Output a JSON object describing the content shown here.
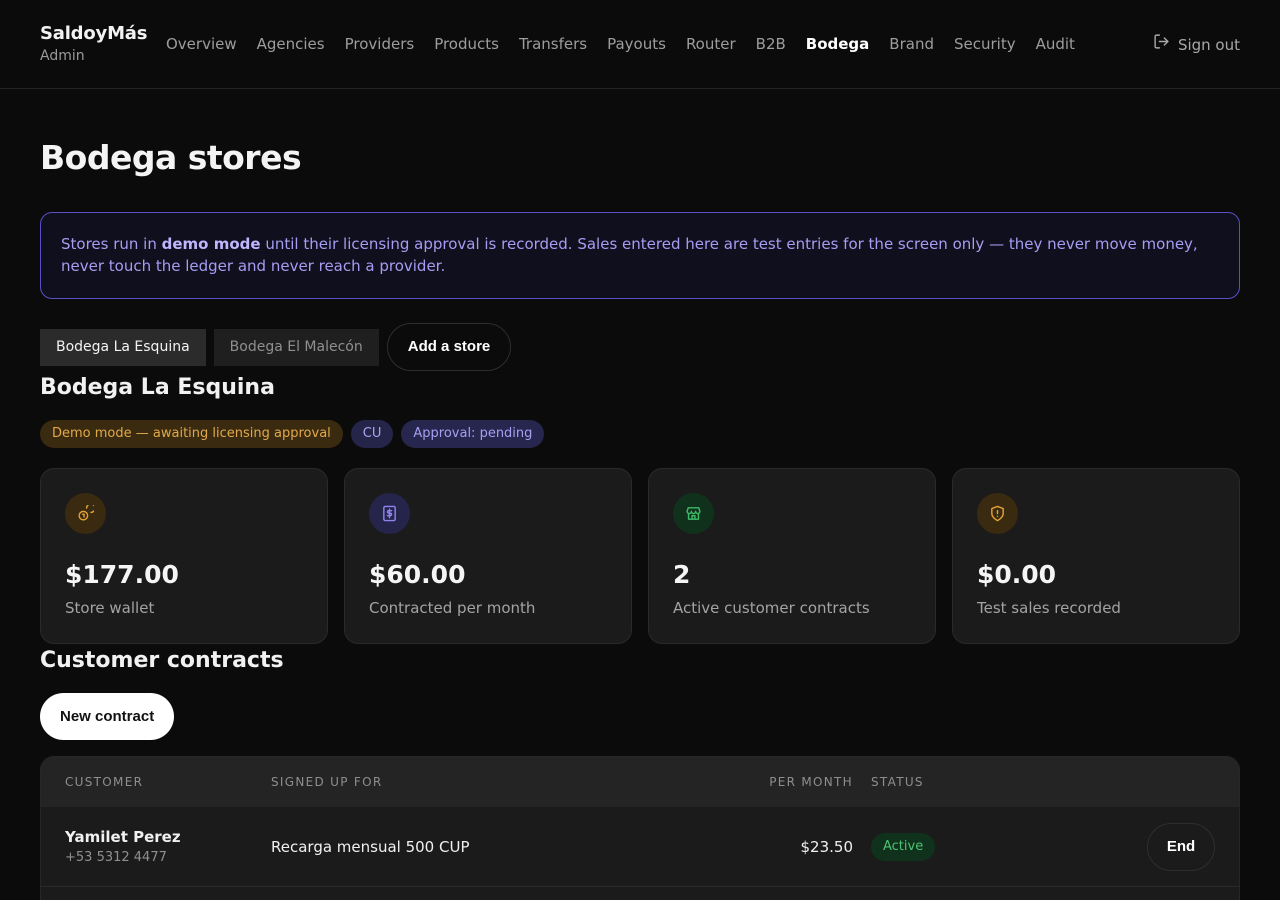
{
  "brand": {
    "name": "SaldoyMás",
    "subtitle": "Admin"
  },
  "nav": {
    "items": [
      {
        "label": "Overview"
      },
      {
        "label": "Agencies"
      },
      {
        "label": "Providers"
      },
      {
        "label": "Products"
      },
      {
        "label": "Transfers"
      },
      {
        "label": "Payouts"
      },
      {
        "label": "Router"
      },
      {
        "label": "B2B"
      },
      {
        "label": "Bodega",
        "active": true
      },
      {
        "label": "Brand"
      },
      {
        "label": "Security"
      },
      {
        "label": "Audit"
      }
    ],
    "signout_label": "Sign out"
  },
  "page": {
    "title": "Bodega stores"
  },
  "notice": {
    "prefix": "Stores run in ",
    "emphasis": "demo mode",
    "suffix": " until their licensing approval is recorded. Sales entered here are test entries for the screen only — they never move money, never touch the ledger and never reach a provider."
  },
  "store_tabs": {
    "tabs": [
      {
        "label": "Bodega La Esquina",
        "active": true
      },
      {
        "label": "Bodega El Malecón",
        "active": false
      }
    ],
    "add_label": "Add a store"
  },
  "store": {
    "name": "Bodega La Esquina",
    "badges": {
      "demo": "Demo mode — awaiting licensing approval",
      "country": "CU",
      "approval": "Approval: pending"
    }
  },
  "stats": [
    {
      "icon": "coins-icon",
      "value": "$177.00",
      "label": "Store wallet",
      "color": "#e2a23a",
      "bg": "#3a2a10"
    },
    {
      "icon": "receipt-dollar-icon",
      "value": "$60.00",
      "label": "Contracted per month",
      "color": "#8c87ee",
      "bg": "#25244a"
    },
    {
      "icon": "store-icon",
      "value": "2",
      "label": "Active customer contracts",
      "color": "#3fb968",
      "bg": "#10321c"
    },
    {
      "icon": "shield-alert-icon",
      "value": "$0.00",
      "label": "Test sales recorded",
      "color": "#e2a23a",
      "bg": "#3a2a10"
    }
  ],
  "contracts": {
    "title": "Customer contracts",
    "new_label": "New contract",
    "columns": {
      "customer": "Customer",
      "signed_up_for": "Signed up for",
      "per_month": "Per month",
      "status": "Status"
    },
    "rows": [
      {
        "name": "Yamilet Perez",
        "phone": "+53 5312 4477",
        "plan": "Recarga mensual 500 CUP",
        "price": "$23.50",
        "status": "Active",
        "action": "End"
      }
    ]
  }
}
